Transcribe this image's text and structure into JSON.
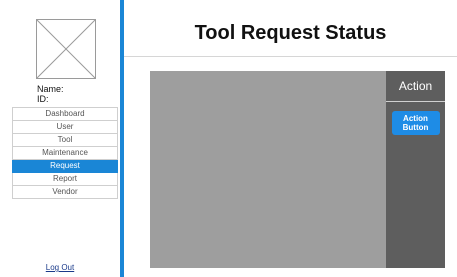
{
  "sidebar": {
    "avatar_icon": "image-placeholder-icon",
    "name_label": "Name:",
    "id_label": "ID:",
    "items": [
      {
        "label": "Dashboard",
        "active": false
      },
      {
        "label": "User",
        "active": false
      },
      {
        "label": "Tool",
        "active": false
      },
      {
        "label": "Maintenance",
        "active": false
      },
      {
        "label": "Request",
        "active": true
      },
      {
        "label": "Report",
        "active": false
      },
      {
        "label": "Vendor",
        "active": false
      }
    ],
    "logout_label": "Log Out"
  },
  "header": {
    "title": "Tool Request Status"
  },
  "action_panel": {
    "title": "Action",
    "button_label": "Action Button"
  },
  "colors": {
    "accent": "#1a86d6",
    "content_bg": "#9e9e9e",
    "panel_bg": "#5e5e5e"
  }
}
